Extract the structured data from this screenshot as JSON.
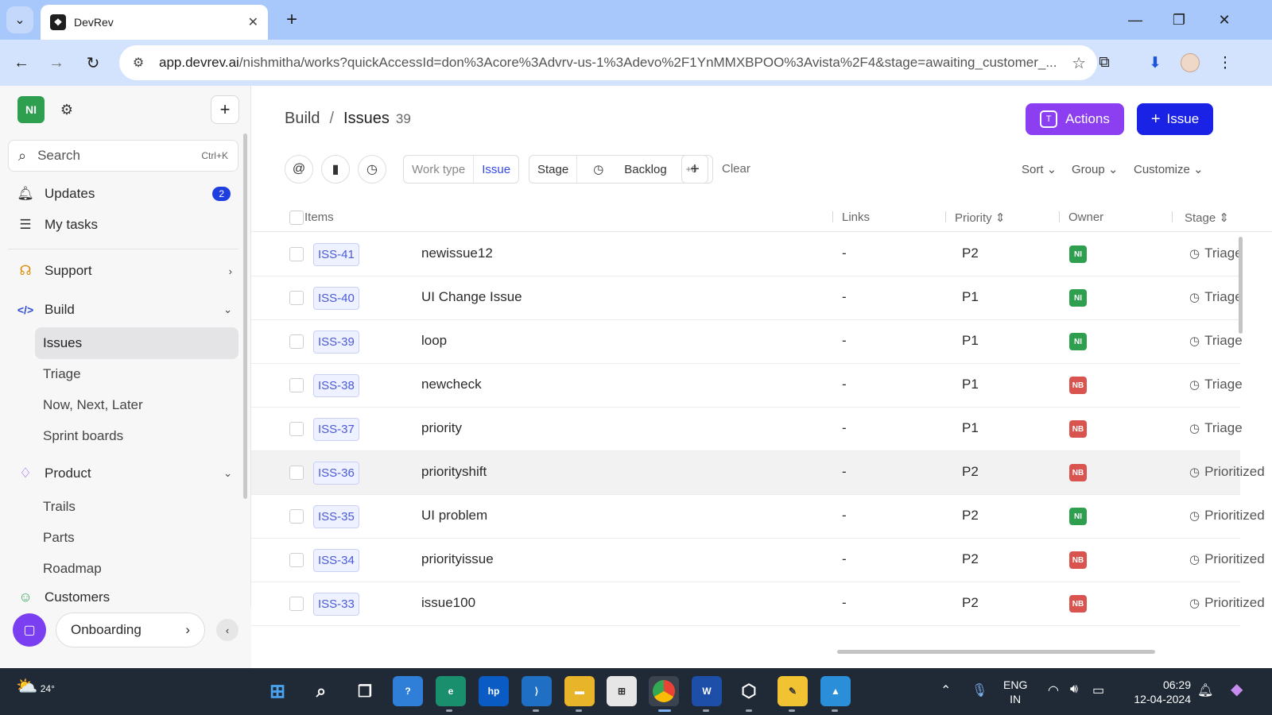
{
  "browser": {
    "tab_title": "DevRev",
    "url_host": "app.devrev.ai",
    "url_path": "/nishmitha/works?quickAccessId=don%3Acore%3Advrv-us-1%3Adevo%2F1YnMMXBPOO%3Avista%2F4&stage=awaiting_customer_...",
    "new_tab": "+",
    "minimize": "—",
    "restore": "❐",
    "close": "✕"
  },
  "sidebar": {
    "workspace_initials": "NI",
    "search_placeholder": "Search",
    "search_shortcut": "Ctrl+K",
    "updates_label": "Updates",
    "updates_count": "2",
    "mytasks_label": "My tasks",
    "support_label": "Support",
    "build_label": "Build",
    "build_items": [
      "Issues",
      "Triage",
      "Now, Next, Later",
      "Sprint boards"
    ],
    "product_label": "Product",
    "product_items": [
      "Trails",
      "Parts",
      "Roadmap"
    ],
    "customers_label": "Customers",
    "onboarding_label": "Onboarding"
  },
  "header": {
    "crumb_root": "Build",
    "crumb_sep": "/",
    "crumb_current": "Issues",
    "count": "39",
    "actions_label": "Actions",
    "issue_label": "Issue"
  },
  "filters": {
    "worktype_key": "Work type",
    "worktype_value": "Issue",
    "stage_key": "Stage",
    "stage_value": "Backlog",
    "stage_more": "+6",
    "clear_label": "Clear",
    "sort_label": "Sort",
    "group_label": "Group",
    "customize_label": "Customize"
  },
  "table": {
    "columns": [
      "Items",
      "Links",
      "Priority",
      "Owner",
      "Stage"
    ],
    "rows": [
      {
        "id": "ISS-41",
        "title": "newissue12",
        "links": "-",
        "priority": "P2",
        "owner": "NI",
        "stage": "Triage"
      },
      {
        "id": "ISS-40",
        "title": "UI Change Issue",
        "links": "-",
        "priority": "P1",
        "owner": "NI",
        "stage": "Triage"
      },
      {
        "id": "ISS-39",
        "title": "loop",
        "links": "-",
        "priority": "P1",
        "owner": "NI",
        "stage": "Triage"
      },
      {
        "id": "ISS-38",
        "title": "newcheck",
        "links": "-",
        "priority": "P1",
        "owner": "NB",
        "stage": "Triage"
      },
      {
        "id": "ISS-37",
        "title": "priority",
        "links": "-",
        "priority": "P1",
        "owner": "NB",
        "stage": "Triage"
      },
      {
        "id": "ISS-36",
        "title": "priorityshift",
        "links": "-",
        "priority": "P2",
        "owner": "NB",
        "stage": "Prioritized"
      },
      {
        "id": "ISS-35",
        "title": "UI problem",
        "links": "-",
        "priority": "P2",
        "owner": "NI",
        "stage": "Prioritized"
      },
      {
        "id": "ISS-34",
        "title": "priorityissue",
        "links": "-",
        "priority": "P2",
        "owner": "NB",
        "stage": "Prioritized"
      },
      {
        "id": "ISS-33",
        "title": "issue100",
        "links": "-",
        "priority": "P2",
        "owner": "NB",
        "stage": "Prioritized"
      }
    ]
  },
  "colors": {
    "owner_ni": "#2e9e4f",
    "owner_nb": "#d9534f",
    "accent_blue": "#1a22e6",
    "accent_purple": "#8b3ff0"
  },
  "taskbar": {
    "temperature": "24°",
    "language_1": "ENG",
    "language_2": "IN",
    "time": "06:29",
    "date": "12-04-2024"
  }
}
